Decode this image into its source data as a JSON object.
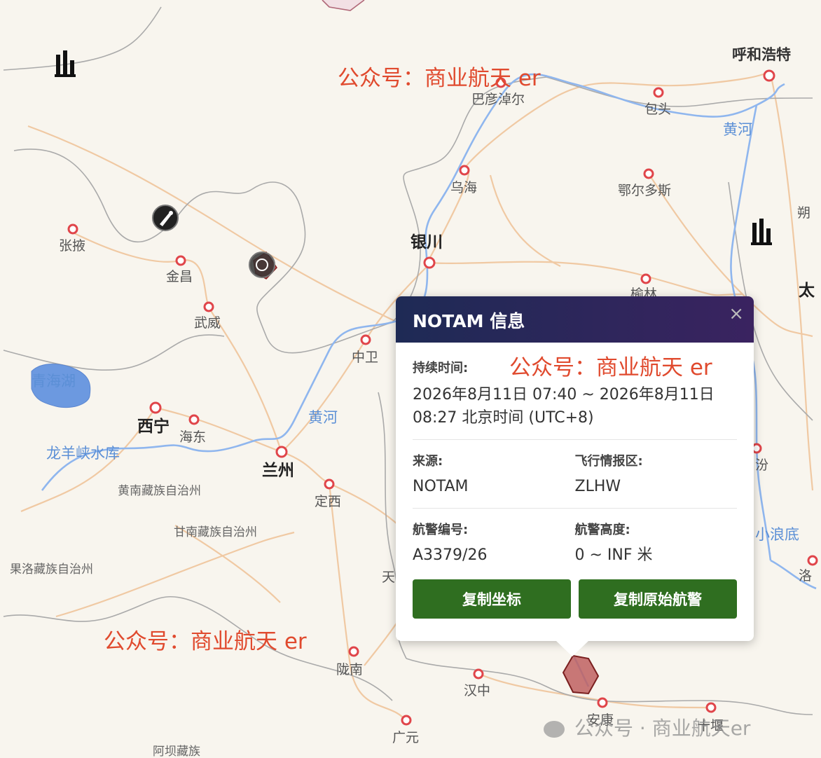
{
  "map": {
    "cities": [
      {
        "name": "呼和浩特",
        "id": "hohhot"
      },
      {
        "name": "巴彦淖尔",
        "id": "bayannur"
      },
      {
        "name": "包头",
        "id": "baotou"
      },
      {
        "name": "乌海",
        "id": "wuhai"
      },
      {
        "name": "鄂尔多斯",
        "id": "ordos"
      },
      {
        "name": "朔",
        "id": "shuo"
      },
      {
        "name": "张掖",
        "id": "zhangye"
      },
      {
        "name": "金昌",
        "id": "jinchang"
      },
      {
        "name": "武威",
        "id": "wuwei"
      },
      {
        "name": "银川",
        "id": "yinchuan"
      },
      {
        "name": "榆林",
        "id": "yulin"
      },
      {
        "name": "太",
        "id": "tai"
      },
      {
        "name": "中卫",
        "id": "zhongwei"
      },
      {
        "name": "西宁",
        "id": "xining"
      },
      {
        "name": "海东",
        "id": "haidong"
      },
      {
        "name": "兰州",
        "id": "lanzhou"
      },
      {
        "name": "定西",
        "id": "dingxi"
      },
      {
        "name": "汾",
        "id": "fen"
      },
      {
        "name": "陇南",
        "id": "longnan"
      },
      {
        "name": "汉中",
        "id": "hanzhong"
      },
      {
        "name": "安康",
        "id": "ankang"
      },
      {
        "name": "广元",
        "id": "guangyuan"
      },
      {
        "name": "十堰",
        "id": "shiyan"
      },
      {
        "name": "洛",
        "id": "luo"
      },
      {
        "name": "天",
        "id": "tian"
      }
    ],
    "water": [
      {
        "name": "黄河",
        "id": "huanghe-1"
      },
      {
        "name": "黄河",
        "id": "huanghe-2"
      },
      {
        "name": "青海湖",
        "id": "qinghaihu"
      },
      {
        "name": "龙羊峡水库",
        "id": "longyangxia"
      },
      {
        "name": "小浪底",
        "id": "xiaolangdi"
      }
    ],
    "regions": [
      {
        "name": "黄南藏族自治州",
        "id": "huangnan"
      },
      {
        "name": "甘南藏族自治州",
        "id": "gannan"
      },
      {
        "name": "果洛藏族自治州",
        "id": "guoluo"
      },
      {
        "name": "阿坝藏族",
        "id": "aba"
      }
    ]
  },
  "watermarks": {
    "top": "公众号：商业航天 er",
    "popup": "公众号：商业航天 er",
    "bottom_left": "公众号：商业航天 er",
    "bottom_right": "公众号 · 商业航天er"
  },
  "popup": {
    "title": "NOTAM 信息",
    "close": "×",
    "duration_label": "持续时间:",
    "duration_value": "2026年8月11日 07:40 ~ 2026年8月11日 08:27 北京时间 (UTC+8)",
    "source_label": "来源:",
    "source_value": "NOTAM",
    "fir_label": "飞行情报区:",
    "fir_value": "ZLHW",
    "notam_no_label": "航警编号:",
    "notam_no_value": "A3379/26",
    "altitude_label": "航警高度:",
    "altitude_value": "0 ~ INF 米",
    "copy_coords": "复制坐标",
    "copy_raw": "复制原始航警"
  },
  "colors": {
    "map_bg": "#f8f5ee",
    "river": "#8fb6ee",
    "road": "#f0c9a3",
    "city_dot": "#e0454a",
    "notam_area": "#b23a3a",
    "button": "#2f6e20",
    "header_start": "#1e2a55",
    "header_end": "#3a2360",
    "watermark": "#e04a2e"
  }
}
